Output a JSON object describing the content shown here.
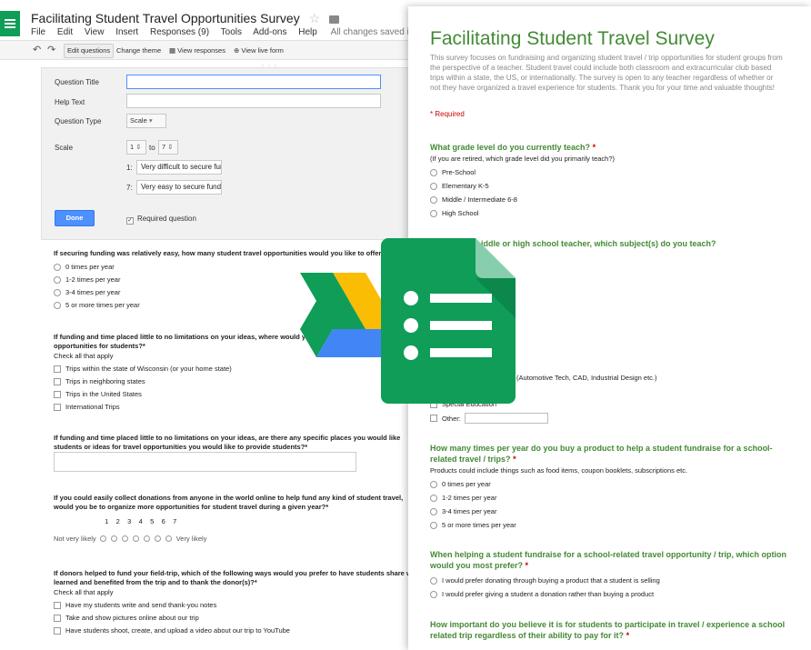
{
  "editor": {
    "doc_title": "Facilitating Student Travel Opportunities Survey",
    "menu": [
      "File",
      "Edit",
      "View",
      "Insert",
      "Responses (9)",
      "Tools",
      "Add-ons",
      "Help"
    ],
    "save_status": "All changes saved in Drive",
    "toolbar": {
      "edit_questions": "Edit questions",
      "change_theme": "Change theme",
      "view_responses": "View responses",
      "view_live_form": "View live form"
    },
    "question_editor": {
      "question_title_label": "Question Title",
      "question_title_value": "",
      "help_text_label": "Help Text",
      "help_text_value": "",
      "question_type_label": "Question Type",
      "question_type_value": "Scale",
      "scale_label": "Scale",
      "scale_from": "1",
      "scale_to_word": "to",
      "scale_to": "7",
      "label1_prefix": "1:",
      "label1_value": "Very difficult to secure funding",
      "label7_prefix": "7:",
      "label7_value": "Very easy to secure funding",
      "done_label": "Done",
      "required_label": "Required question"
    },
    "questions": [
      {
        "title": "If securing funding was relatively easy, how many student travel opportunities would you like to offer?",
        "options": [
          "0 times per year",
          "1-2 times per year",
          "3-4 times per year",
          "5 or more times per year"
        ]
      },
      {
        "title": "If funding and time placed little to no limitations on your ideas, where would you like to offer",
        "title2": "opportunities for students?*",
        "help": "Check all that apply",
        "options": [
          "Trips within the state of Wisconsin (or your home state)",
          "Trips in neighboring states",
          "Trips in the United States",
          "International Trips"
        ]
      },
      {
        "title": "If funding and time placed little to no limitations on your ideas, are there any specific places you would like",
        "title2": "students or ideas for travel opportunities you would like to provide students?*"
      },
      {
        "title": "If you could easily collect donations from anyone in the world online to help fund any kind of student travel,",
        "title2": "would you be to organize more opportunities for student travel during a given year?*",
        "scale_numbers": [
          "1",
          "2",
          "3",
          "4",
          "5",
          "6",
          "7"
        ],
        "scale_low": "Not very likely",
        "scale_high": "Very likely"
      },
      {
        "title": "If donors helped to fund your field-trip, which of the following ways would you prefer to have students share what they",
        "title2": "learned and benefited from the trip and to thank the donor(s)?*",
        "help": "Check all that apply",
        "options": [
          "Have my students write and send thank-you notes",
          "Take and show pictures online about our trip",
          "Have students shoot, create, and upload a video about our trip to YouTube"
        ]
      }
    ]
  },
  "live_form": {
    "title": "Facilitating Student Travel Survey",
    "description": "This survey focuses on fundraising and organizing student travel / trip opportunities for student groups from the perspective of a teacher. Student travel could include both classroom and extracurricular club based trips within a state, the US, or internationally. The survey is open to any teacher regardless of whether or not they have organized a travel experience for students. Thank you for your time and valuable thoughts!",
    "required_note": "* Required",
    "questions": [
      {
        "title": "What grade level do you currently teach?",
        "help": "(If you are retired, which grade level did you primarily teach?)",
        "options": [
          "Pre-School",
          "Elementary K-5",
          "Middle / Intermediate 6-8",
          "High School"
        ]
      },
      {
        "title": "If you are a middle or high school teacher, which subject(s) do you teach?",
        "visible_title": "iddle or high school teacher, which subject(s) do you teach?",
        "partial_fragments": [
          "ts",
          "(Automotive Tech, CAD, Industrial Design etc.)"
        ],
        "options": [
          "Special Education",
          "Other:"
        ]
      },
      {
        "title": "How many times per year do you buy a product to help a student fundraise for a school-related travel / trips?",
        "help": "Products could include things such as food items, coupon booklets, subscriptions etc.",
        "options": [
          "0 times per year",
          "1-2 times per year",
          "3-4 times per year",
          "5 or more times per year"
        ]
      },
      {
        "title": "When helping a student fundraise for a school-related travel opportunity / trip, which option would you most prefer?",
        "options": [
          "I would prefer donating through buying a product that a student is selling",
          "I would prefer giving a student a donation rather than buying a product"
        ]
      },
      {
        "title": "How important do you believe it is for students to participate in travel / experience a school related trip regardless of their ability to pay for it?"
      }
    ]
  },
  "colors": {
    "forms_green": "#0f9d58",
    "form_title_green": "#438a35",
    "done_blue": "#4d90fe",
    "required_red": "#cc0000"
  },
  "icons": [
    "forms-app-icon",
    "star-icon",
    "folder-icon",
    "undo-icon",
    "redo-icon",
    "google-drive-logo",
    "google-forms-logo"
  ]
}
